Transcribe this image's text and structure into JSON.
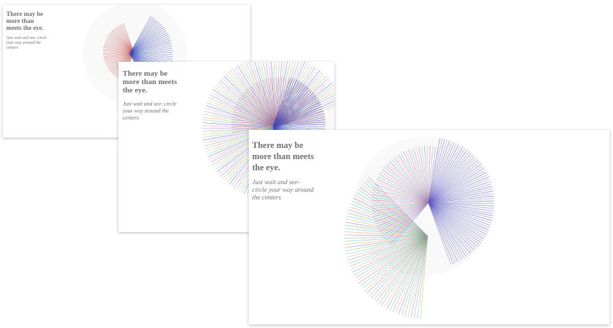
{
  "cards": [
    {
      "title": "There may be more than meets the eye.",
      "subtitle": "Just wait and see- circle your way around the centers"
    },
    {
      "title": "There may be more than meets the eye.",
      "subtitle": "Just wait and see- circle your way around the centers"
    },
    {
      "title": "There may be more than meets the eye.",
      "subtitle": "Just wait and see- circle your way around the centers"
    }
  ],
  "palette": {
    "red": "#c85a5a",
    "blue": "#3a4fb8",
    "teal": "#48c2c4",
    "orange": "#f4a640",
    "green": "#6cb76a",
    "purple": "#8b6bd0",
    "pink": "#e889c2",
    "gray": "#707070"
  }
}
